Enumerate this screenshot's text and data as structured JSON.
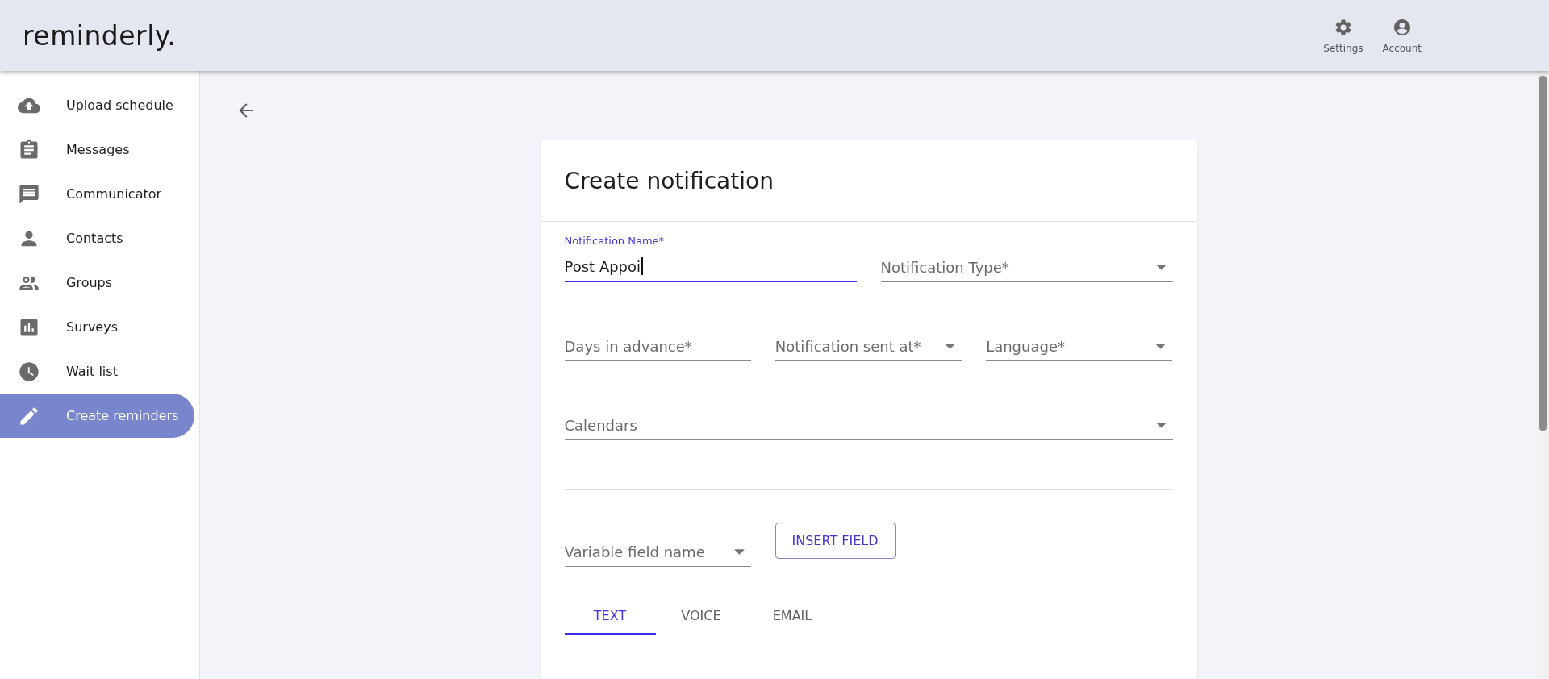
{
  "app": {
    "logo": "reminderly.",
    "actions": [
      {
        "label": "Settings",
        "kind": "settings"
      },
      {
        "label": "Account",
        "kind": "account"
      }
    ]
  },
  "sidebar": {
    "items": [
      {
        "label": "Upload schedule",
        "kind": "upload",
        "selected": false
      },
      {
        "label": "Messages",
        "kind": "clipboard",
        "selected": false
      },
      {
        "label": "Communicator",
        "kind": "chat",
        "selected": false
      },
      {
        "label": "Contacts",
        "kind": "person",
        "selected": false
      },
      {
        "label": "Groups",
        "kind": "people",
        "selected": false
      },
      {
        "label": "Surveys",
        "kind": "chart",
        "selected": false
      },
      {
        "label": "Wait list",
        "kind": "clock",
        "selected": false
      },
      {
        "label": "Create reminders",
        "kind": "pencil",
        "selected": true
      }
    ]
  },
  "form": {
    "title": "Create notification",
    "rows": [
      [
        {
          "kind": "text",
          "label": "Notification Name*",
          "value": "Post Appoi",
          "focused": true
        },
        {
          "kind": "select",
          "placeholder": "Notification Type*",
          "focused": false
        }
      ],
      [
        {
          "kind": "text",
          "placeholder": "Days in advance*",
          "focused": false
        },
        {
          "kind": "select",
          "placeholder": "Notification sent at*",
          "focused": false
        },
        {
          "kind": "select",
          "placeholder": "Language*",
          "focused": false
        }
      ],
      [
        {
          "kind": "select",
          "placeholder": "Calendars",
          "focused": false
        }
      ]
    ],
    "variable_field": {
      "placeholder": "Variable field name"
    },
    "insert_button": "INSERT FIELD",
    "tabs": [
      {
        "label": "TEXT",
        "selected": true
      },
      {
        "label": "VOICE",
        "selected": false
      },
      {
        "label": "EMAIL",
        "selected": false
      }
    ]
  }
}
